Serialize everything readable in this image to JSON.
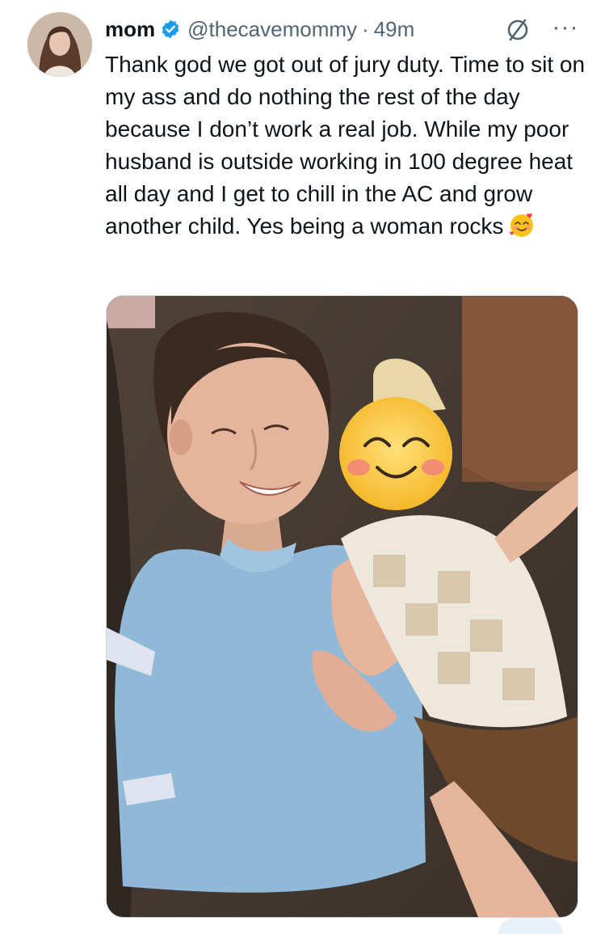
{
  "tweet": {
    "display_name": "mom",
    "handle": "@thecavemommy",
    "separator": "·",
    "time": "49m",
    "text": "Thank god we got out of jury duty. Time to sit on my ass and do nothing the rest of the day because I don’t work a real job. While my poor husband is outside working in 100 degree heat all day and I get to chill in the AC and grow another child. Yes being a woman rocks",
    "emoji": "smiling-face-with-hearts",
    "more_label": "···"
  },
  "colors": {
    "text": "#0f1419",
    "secondary": "#536471",
    "verified": "#1d9bf0",
    "border": "#cfd9de"
  },
  "icons": {
    "verified": "verified-badge-icon",
    "grok": "grok-icon",
    "more": "more-icon"
  },
  "media": {
    "type": "photo",
    "description_kind": "selfie-photo"
  }
}
